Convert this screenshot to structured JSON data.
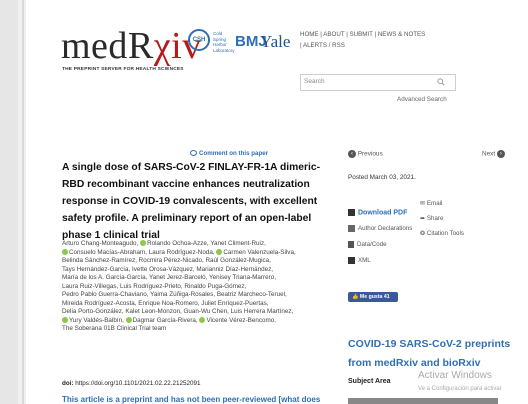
{
  "header": {
    "logo_main": "medR",
    "logo_rx": "χiv",
    "tagline": "THE PREPRINT SERVER FOR HEALTH SCIENCES",
    "csh_badge": "CSH",
    "csh_text": "Cold Spring Harbor Laboratory",
    "bmj": "BMJ",
    "yale": "Yale",
    "nav": [
      "HOME",
      "ABOUT",
      "SUBMIT",
      "NEWS & NOTES",
      "ALERTS / RSS"
    ],
    "search_placeholder": "Search",
    "advanced_search": "Advanced Search"
  },
  "article": {
    "comment_link": "Comment on this paper",
    "title": "A single dose of SARS-CoV-2 FINLAY-FR-1A dimeric-RBD recombinant vaccine enhances neutralization response in COVID-19 convalescents, with excellent safety profile. A preliminary report of an open-label phase 1 clinical trial",
    "authors": [
      "Arturo Chang-Monteagudo,",
      "Rolando Ochoa-Azze,",
      "Yanet Climent-Ruiz,",
      "Consuelo Macías-Abraham, Laura Rodríguez-Noda,",
      "Carmen Valenzuela-Silva,",
      "Belinda Sánchez-Ramírez, Rocmira Pérez-Nicado, Raúl González-Mugica,",
      "Tays Hernández-García, Ivette Orosa-Vázquez, Marianniz Díaz-Hernández,",
      "María de los A. García-García, Yanet Jerez-Barceló, Yenisey Triana-Marrero,",
      "Laura Ruiz-Villegas, Luis Rodríguez-Prieto, Rinaldo Puga-Gómez,",
      "Pedro Pablo Guerra-Chaviano, Yaima Zúñiga-Rosales, Beatriz Marcheco-Teruel,",
      "Mireida Rodríguez-Acosta, Enrique Noa-Romero, Juliet Enríquez-Puertas,",
      "Delia Porto-González, Kalet Leon-Monzon, Guan-Wu Chen, Luis Herrera Martínez,",
      "Yury Valdés-Balbín,",
      "Dagmar García-Rivera,",
      "Vicente Vérez-Bencomo,",
      "The Soberana 01B Clinical Trial team"
    ],
    "doi_label": "doi:",
    "doi_value": "https://doi.org/10.1101/2021.02.22.21252091",
    "preprint_notice": "This article is a preprint and has not been peer-reviewed [what does"
  },
  "sidebar": {
    "previous": "Previous",
    "next": "Next",
    "posted": "Posted March 03, 2021.",
    "download_pdf": "Download PDF",
    "author_declarations": "Author Declarations",
    "data_code": "Data/Code",
    "xml": "XML",
    "email": "Email",
    "share": "Share",
    "citation_tools": "Citation Tools",
    "fb_like": "Me gusta 41",
    "collections_title": "COVID-19 SARS-CoV-2 preprints from medRxiv and bioRxiv",
    "subject_area": "Subject Area"
  },
  "overlay": {
    "activate_title": "Activar Windows",
    "activate_sub": "Ve a Configuración para activar"
  }
}
